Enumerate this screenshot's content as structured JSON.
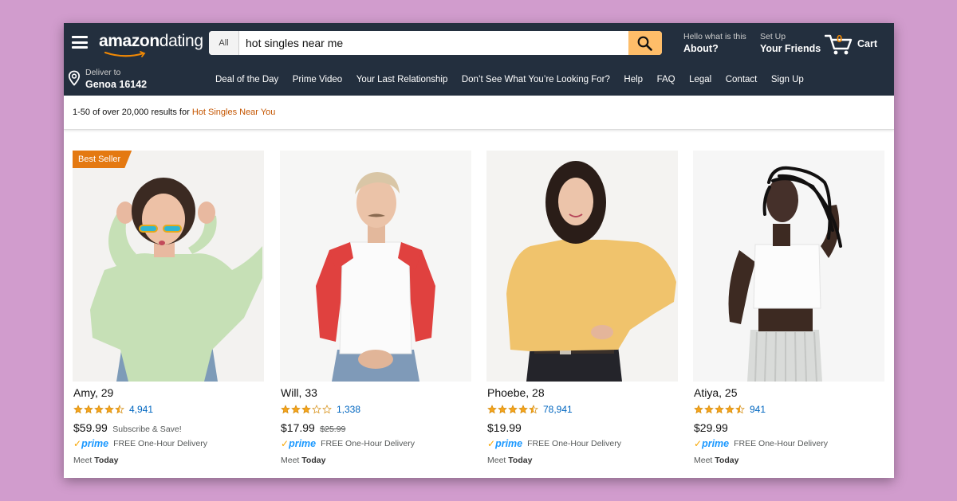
{
  "header": {
    "logo": {
      "part1": "amazon",
      "part2": "dating"
    },
    "search": {
      "category": "All",
      "query": "hot singles near me"
    },
    "about": {
      "line1": "Hello what is this",
      "line2": "About?"
    },
    "signup": {
      "line1": "Set Up",
      "line2": "Your Friends"
    },
    "cart": {
      "count": "0",
      "label": "Cart"
    }
  },
  "subnav": {
    "deliver": {
      "line1": "Deliver to",
      "line2": "Genoa 16142"
    },
    "links": [
      "Deal of the Day",
      "Prime Video",
      "Your Last Relationship",
      "Don’t See What You’re Looking For?",
      "Help",
      "FAQ",
      "Legal",
      "Contact",
      "Sign Up"
    ]
  },
  "results": {
    "prefix": "1-50 of over 20,000 results for",
    "query": "Hot Singles Near You"
  },
  "products": [
    {
      "badge": "Best Seller",
      "name": "Amy, 29",
      "stars": 4.5,
      "reviews": "4,941",
      "price": "$59.99",
      "subtext": "Subscribe & Save!",
      "old_price": "",
      "prime": "prime",
      "delivery": "FREE One-Hour Delivery",
      "meet_prefix": "Meet",
      "meet_when": "Today"
    },
    {
      "badge": "",
      "name": "Will, 33",
      "stars": 3,
      "reviews": "1,338",
      "price": "$17.99",
      "subtext": "",
      "old_price": "$25.99",
      "prime": "prime",
      "delivery": "FREE One-Hour Delivery",
      "meet_prefix": "Meet",
      "meet_when": "Today"
    },
    {
      "badge": "",
      "name": "Phoebe, 28",
      "stars": 4.5,
      "reviews": "78,941",
      "price": "$19.99",
      "subtext": "",
      "old_price": "",
      "prime": "prime",
      "delivery": "FREE One-Hour Delivery",
      "meet_prefix": "Meet",
      "meet_when": "Today"
    },
    {
      "badge": "",
      "name": "Atiya, 25",
      "stars": 4.5,
      "reviews": "941",
      "price": "$29.99",
      "subtext": "",
      "old_price": "",
      "prime": "prime",
      "delivery": "FREE One-Hour Delivery",
      "meet_prefix": "Meet",
      "meet_when": "Today"
    }
  ],
  "colors": {
    "page_bg": "#d19ccd",
    "header_bg": "#232f3e",
    "search_button": "#febd69",
    "badge": "#e47911",
    "star": "#f4a41c",
    "link": "#0066c0",
    "query_highlight": "#c45500",
    "prime_blue": "#1a98ff"
  },
  "icons": [
    "menu-icon",
    "search-icon",
    "cart-icon",
    "location-pin-icon",
    "star-icon",
    "prime-check-icon"
  ]
}
